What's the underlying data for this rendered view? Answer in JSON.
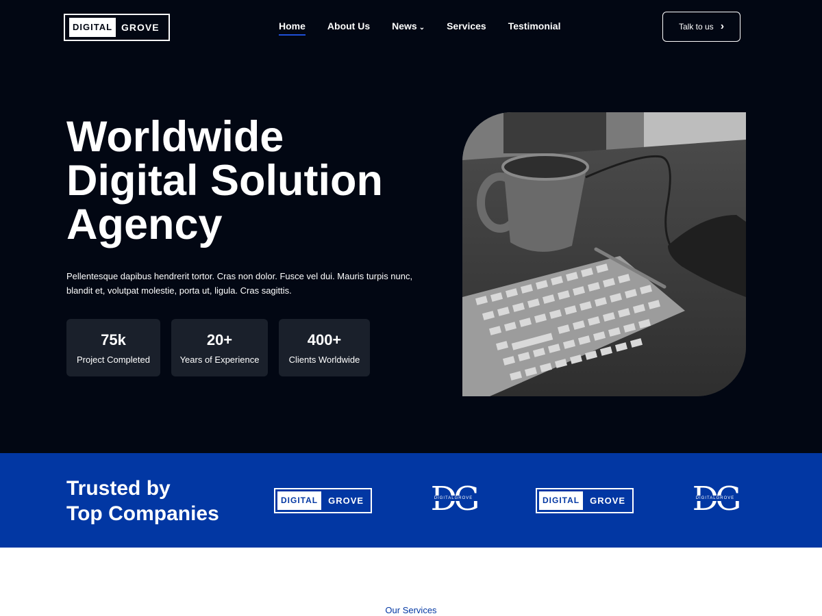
{
  "header": {
    "logo": {
      "part1": "DIGITAL",
      "part2": "GROVE"
    },
    "nav": [
      {
        "label": "Home",
        "active": true
      },
      {
        "label": "About Us",
        "active": false
      },
      {
        "label": "News",
        "active": false,
        "has_dropdown": true
      },
      {
        "label": "Services",
        "active": false
      },
      {
        "label": "Testimonial",
        "active": false
      }
    ],
    "cta": {
      "label": "Talk to us",
      "icon": "chevron-right-icon"
    }
  },
  "hero": {
    "headline_lines": [
      "Worldwide",
      "Digital Solution",
      "Agency"
    ],
    "description": "Pellentesque dapibus hendrerit tortor. Cras non dolor. Fusce vel dui. Mauris turpis nunc, blandit et, volutpat molestie, porta ut, ligula. Cras sagittis.",
    "stats": [
      {
        "value": "75k",
        "label": "Project Completed"
      },
      {
        "value": "20+",
        "label": "Years of Experience"
      },
      {
        "value": "400+",
        "label": "Clients Worldwide"
      }
    ],
    "image": "grayscale photo of coffee mug, keyboard and hand on mouse"
  },
  "trusted": {
    "title_lines": [
      "Trusted by",
      "Top Companies"
    ],
    "logos": [
      {
        "type": "box",
        "part1": "DIGITAL",
        "part2": "GROVE"
      },
      {
        "type": "monogram",
        "letters": "DG",
        "sub": "DIGITALGROVE"
      },
      {
        "type": "box",
        "part1": "DIGITAL",
        "part2": "GROVE"
      },
      {
        "type": "monogram",
        "letters": "DG",
        "sub": "DIGITALGROVE"
      }
    ]
  },
  "services": {
    "label": "Our Services"
  },
  "colors": {
    "hero_bg": "#020713",
    "stat_bg": "#1a202b",
    "brand_blue": "#0237a3",
    "nav_underline": "#1f4fd8",
    "text_light": "#ffffff"
  }
}
